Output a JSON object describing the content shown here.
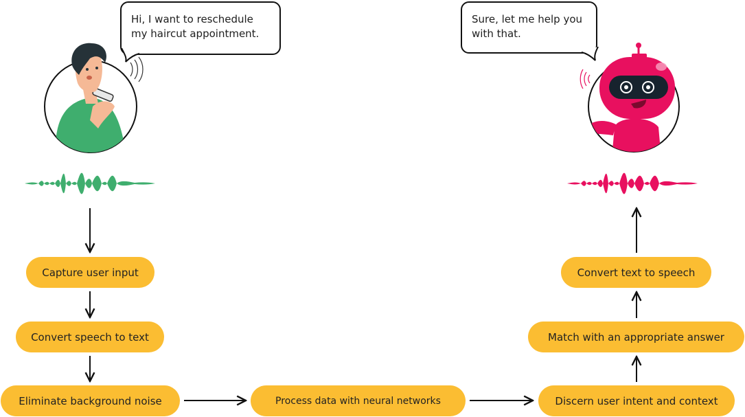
{
  "user": {
    "speech": "Hi, I want to reschedule my haircut appointment.",
    "speech_lines": [
      "Hi, I want to reschedule",
      "my haircut appointment."
    ],
    "accent_color": "#3fae6e"
  },
  "bot": {
    "speech": "Sure, let me help you with that.",
    "speech_lines": [
      "Sure, let me help you",
      "with that."
    ],
    "accent_color": "#e8105f"
  },
  "pill_color": "#fbbd32",
  "steps": {
    "capture": "Capture user input",
    "stt": "Convert speech to text",
    "noise": "Eliminate background noise",
    "neural": "Process data with neural networks",
    "intent": "Discern user intent and context",
    "match": "Match with an appropriate answer",
    "tts": "Convert text to speech"
  }
}
